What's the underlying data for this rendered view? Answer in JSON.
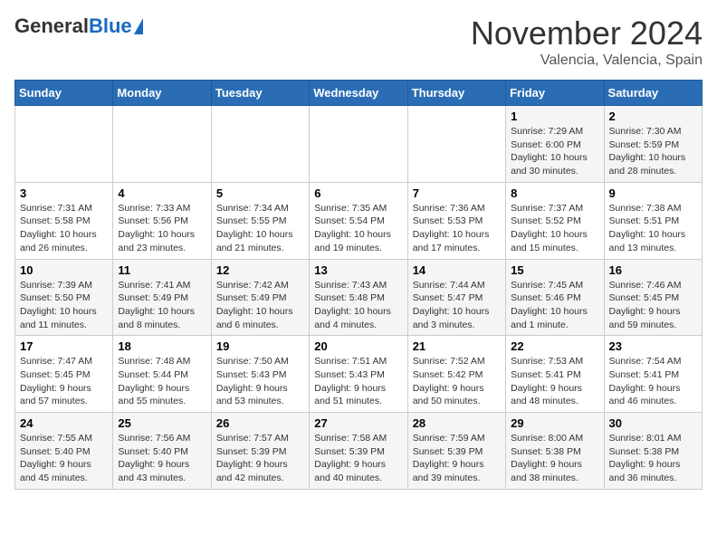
{
  "header": {
    "logo_general": "General",
    "logo_blue": "Blue",
    "month_title": "November 2024",
    "subtitle": "Valencia, Valencia, Spain"
  },
  "days_of_week": [
    "Sunday",
    "Monday",
    "Tuesday",
    "Wednesday",
    "Thursday",
    "Friday",
    "Saturday"
  ],
  "weeks": [
    [
      {
        "day": "",
        "info": ""
      },
      {
        "day": "",
        "info": ""
      },
      {
        "day": "",
        "info": ""
      },
      {
        "day": "",
        "info": ""
      },
      {
        "day": "",
        "info": ""
      },
      {
        "day": "1",
        "info": "Sunrise: 7:29 AM\nSunset: 6:00 PM\nDaylight: 10 hours and 30 minutes."
      },
      {
        "day": "2",
        "info": "Sunrise: 7:30 AM\nSunset: 5:59 PM\nDaylight: 10 hours and 28 minutes."
      }
    ],
    [
      {
        "day": "3",
        "info": "Sunrise: 7:31 AM\nSunset: 5:58 PM\nDaylight: 10 hours and 26 minutes."
      },
      {
        "day": "4",
        "info": "Sunrise: 7:33 AM\nSunset: 5:56 PM\nDaylight: 10 hours and 23 minutes."
      },
      {
        "day": "5",
        "info": "Sunrise: 7:34 AM\nSunset: 5:55 PM\nDaylight: 10 hours and 21 minutes."
      },
      {
        "day": "6",
        "info": "Sunrise: 7:35 AM\nSunset: 5:54 PM\nDaylight: 10 hours and 19 minutes."
      },
      {
        "day": "7",
        "info": "Sunrise: 7:36 AM\nSunset: 5:53 PM\nDaylight: 10 hours and 17 minutes."
      },
      {
        "day": "8",
        "info": "Sunrise: 7:37 AM\nSunset: 5:52 PM\nDaylight: 10 hours and 15 minutes."
      },
      {
        "day": "9",
        "info": "Sunrise: 7:38 AM\nSunset: 5:51 PM\nDaylight: 10 hours and 13 minutes."
      }
    ],
    [
      {
        "day": "10",
        "info": "Sunrise: 7:39 AM\nSunset: 5:50 PM\nDaylight: 10 hours and 11 minutes."
      },
      {
        "day": "11",
        "info": "Sunrise: 7:41 AM\nSunset: 5:49 PM\nDaylight: 10 hours and 8 minutes."
      },
      {
        "day": "12",
        "info": "Sunrise: 7:42 AM\nSunset: 5:49 PM\nDaylight: 10 hours and 6 minutes."
      },
      {
        "day": "13",
        "info": "Sunrise: 7:43 AM\nSunset: 5:48 PM\nDaylight: 10 hours and 4 minutes."
      },
      {
        "day": "14",
        "info": "Sunrise: 7:44 AM\nSunset: 5:47 PM\nDaylight: 10 hours and 3 minutes."
      },
      {
        "day": "15",
        "info": "Sunrise: 7:45 AM\nSunset: 5:46 PM\nDaylight: 10 hours and 1 minute."
      },
      {
        "day": "16",
        "info": "Sunrise: 7:46 AM\nSunset: 5:45 PM\nDaylight: 9 hours and 59 minutes."
      }
    ],
    [
      {
        "day": "17",
        "info": "Sunrise: 7:47 AM\nSunset: 5:45 PM\nDaylight: 9 hours and 57 minutes."
      },
      {
        "day": "18",
        "info": "Sunrise: 7:48 AM\nSunset: 5:44 PM\nDaylight: 9 hours and 55 minutes."
      },
      {
        "day": "19",
        "info": "Sunrise: 7:50 AM\nSunset: 5:43 PM\nDaylight: 9 hours and 53 minutes."
      },
      {
        "day": "20",
        "info": "Sunrise: 7:51 AM\nSunset: 5:43 PM\nDaylight: 9 hours and 51 minutes."
      },
      {
        "day": "21",
        "info": "Sunrise: 7:52 AM\nSunset: 5:42 PM\nDaylight: 9 hours and 50 minutes."
      },
      {
        "day": "22",
        "info": "Sunrise: 7:53 AM\nSunset: 5:41 PM\nDaylight: 9 hours and 48 minutes."
      },
      {
        "day": "23",
        "info": "Sunrise: 7:54 AM\nSunset: 5:41 PM\nDaylight: 9 hours and 46 minutes."
      }
    ],
    [
      {
        "day": "24",
        "info": "Sunrise: 7:55 AM\nSunset: 5:40 PM\nDaylight: 9 hours and 45 minutes."
      },
      {
        "day": "25",
        "info": "Sunrise: 7:56 AM\nSunset: 5:40 PM\nDaylight: 9 hours and 43 minutes."
      },
      {
        "day": "26",
        "info": "Sunrise: 7:57 AM\nSunset: 5:39 PM\nDaylight: 9 hours and 42 minutes."
      },
      {
        "day": "27",
        "info": "Sunrise: 7:58 AM\nSunset: 5:39 PM\nDaylight: 9 hours and 40 minutes."
      },
      {
        "day": "28",
        "info": "Sunrise: 7:59 AM\nSunset: 5:39 PM\nDaylight: 9 hours and 39 minutes."
      },
      {
        "day": "29",
        "info": "Sunrise: 8:00 AM\nSunset: 5:38 PM\nDaylight: 9 hours and 38 minutes."
      },
      {
        "day": "30",
        "info": "Sunrise: 8:01 AM\nSunset: 5:38 PM\nDaylight: 9 hours and 36 minutes."
      }
    ]
  ]
}
